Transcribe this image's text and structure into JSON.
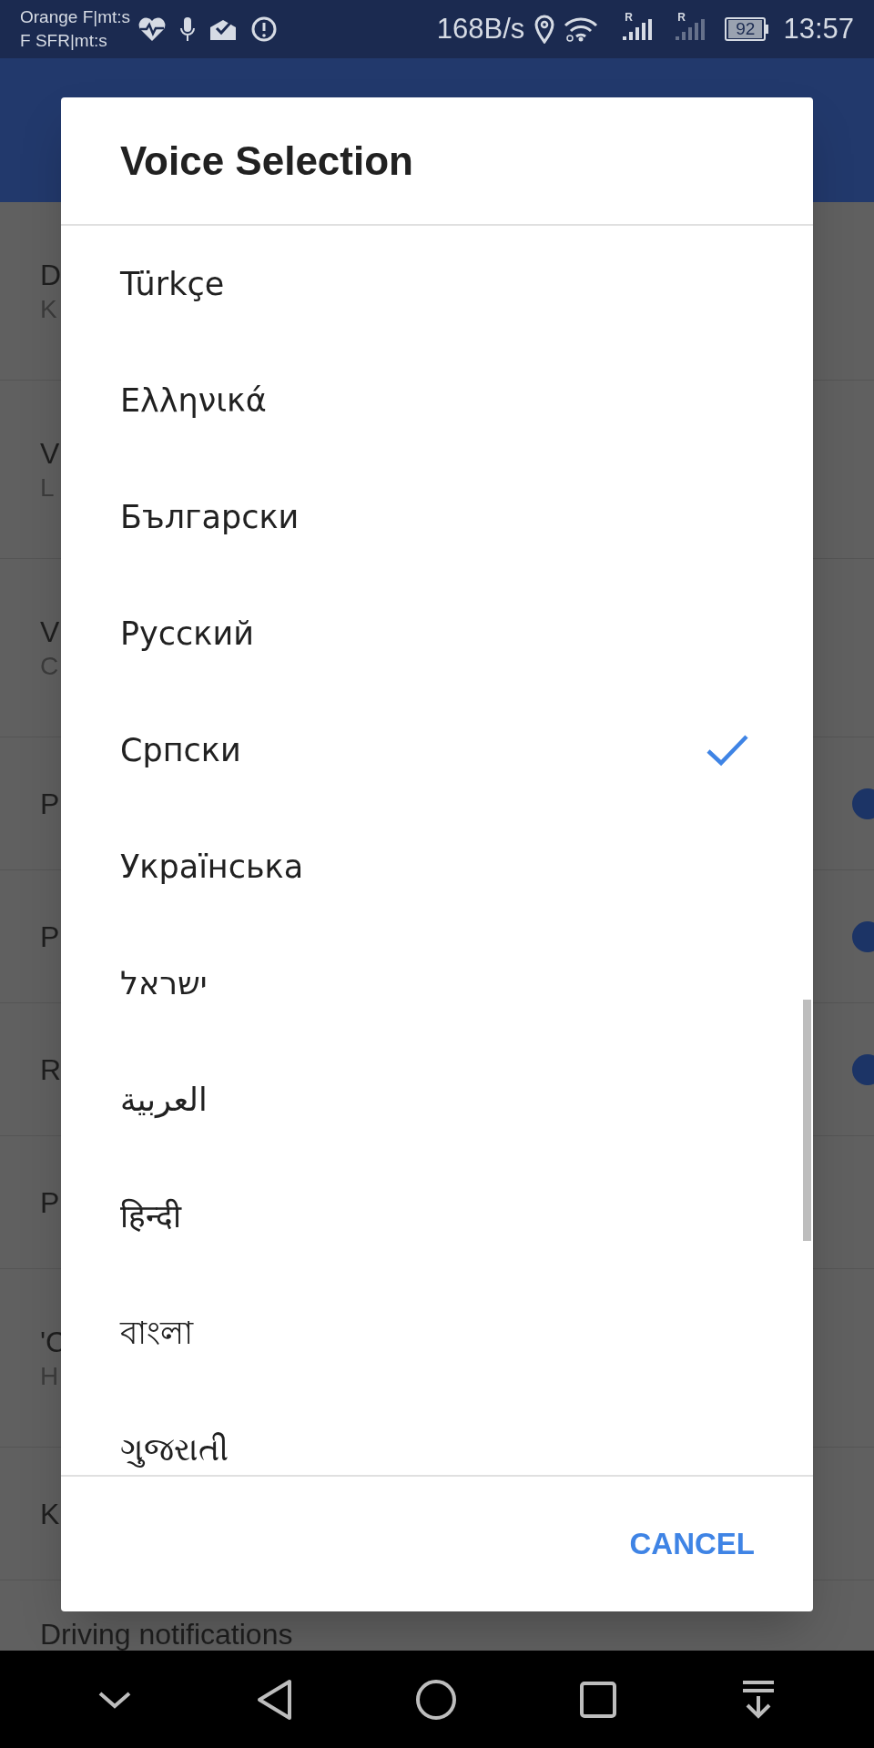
{
  "status_bar": {
    "carriers": [
      "Orange F|mt:s",
      "F SFR|mt:s"
    ],
    "speed": "168B/s",
    "signal_labels": [
      "R",
      "R"
    ],
    "battery": "92",
    "time": "13:57"
  },
  "settings_rows": [
    {
      "title": "D",
      "subtitle": "K"
    },
    {
      "title": "V",
      "subtitle": "L"
    },
    {
      "title": "V",
      "subtitle": "C"
    },
    {
      "title": "P",
      "toggle": {
        "on": true
      }
    },
    {
      "title": "P",
      "toggle": {
        "on": true
      }
    },
    {
      "title": "R",
      "toggle": {
        "on": true
      }
    },
    {
      "title": "P"
    },
    {
      "title": "'C",
      "subtitle": "H"
    },
    {
      "title": "K"
    },
    {
      "title": "Driving notifications"
    }
  ],
  "dialog": {
    "title": "Voice Selection",
    "voices": [
      {
        "label": "Türkçe",
        "selected": false
      },
      {
        "label": "Ελληνικά",
        "selected": false
      },
      {
        "label": "Български",
        "selected": false
      },
      {
        "label": "Русский",
        "selected": false
      },
      {
        "label": "Српски",
        "selected": true
      },
      {
        "label": "Українська",
        "selected": false
      },
      {
        "label": "ישראל",
        "selected": false
      },
      {
        "label": "العربية",
        "selected": false
      },
      {
        "label": "हिन्दी",
        "selected": false
      },
      {
        "label": "বাংলা",
        "selected": false
      },
      {
        "label": "ગુજરાતી",
        "selected": false
      }
    ],
    "cancel": "CANCEL"
  }
}
